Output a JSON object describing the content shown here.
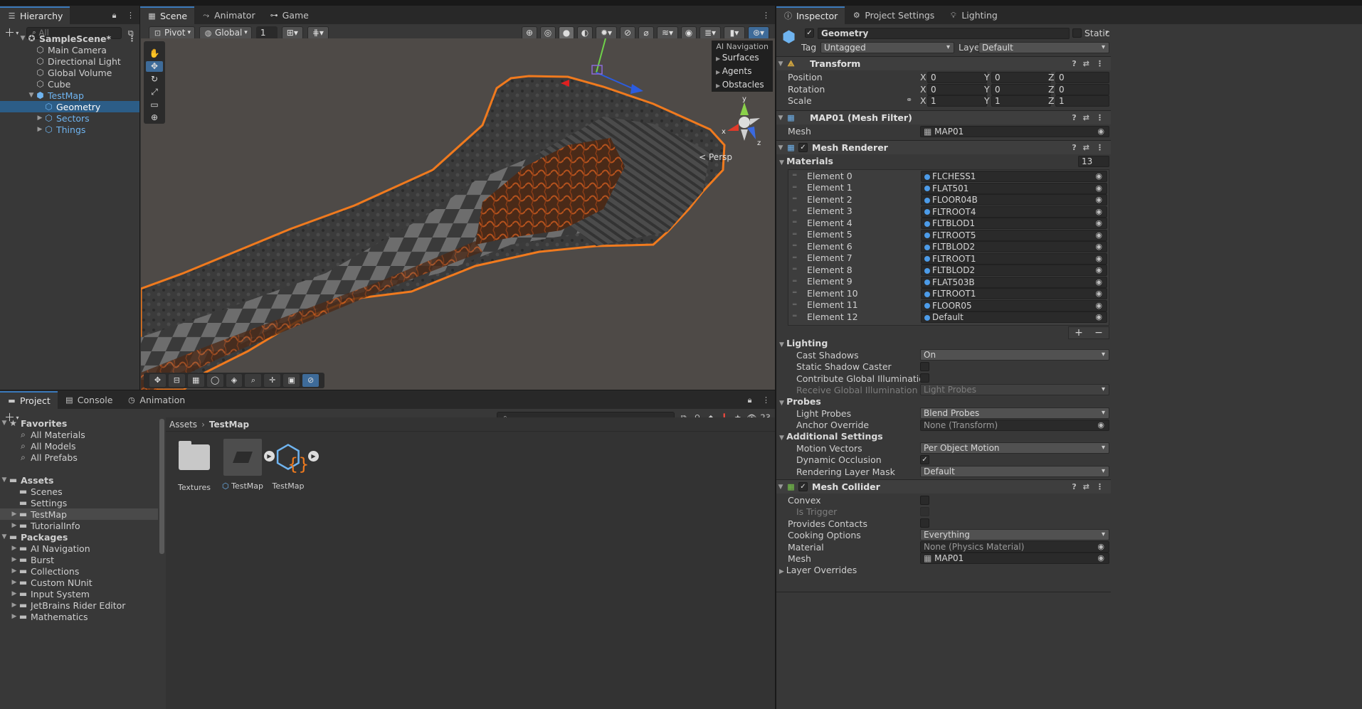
{
  "hierarchy": {
    "tab_label": "Hierarchy",
    "search_placeholder": "All",
    "items": [
      {
        "label": "SampleScene*"
      },
      {
        "label": "Main Camera"
      },
      {
        "label": "Directional Light"
      },
      {
        "label": "Global Volume"
      },
      {
        "label": "Cube"
      },
      {
        "label": "TestMap"
      },
      {
        "label": "Geometry"
      },
      {
        "label": "Sectors"
      },
      {
        "label": "Things"
      }
    ]
  },
  "scene": {
    "tabs": [
      "Scene",
      "Animator",
      "Game"
    ],
    "pivot_label": "Pivot",
    "global_label": "Global",
    "grid_value": "1",
    "ai_navigation": {
      "title": "AI Navigation",
      "items": [
        "Surfaces",
        "Agents",
        "Obstacles"
      ]
    },
    "gizmo_axes": {
      "x": "x",
      "y": "y",
      "z": "z"
    },
    "persp_label": "Persp"
  },
  "inspector": {
    "tabs": [
      "Inspector",
      "Project Settings",
      "Lighting"
    ],
    "object_name": "Geometry",
    "static_label": "Static",
    "tag_label": "Tag",
    "tag_value": "Untagged",
    "layer_label": "Layer",
    "layer_value": "Default",
    "transform": {
      "title": "Transform",
      "position_label": "Position",
      "rotation_label": "Rotation",
      "scale_label": "Scale",
      "x_label": "X",
      "y_label": "Y",
      "z_label": "Z",
      "position": [
        "0",
        "0",
        "0"
      ],
      "rotation": [
        "0",
        "0",
        "0"
      ],
      "scale": [
        "1",
        "1",
        "1"
      ]
    },
    "mesh_filter": {
      "title": "MAP01 (Mesh Filter)",
      "mesh_label": "Mesh",
      "mesh_value": "MAP01"
    },
    "mesh_renderer": {
      "title": "Mesh Renderer",
      "materials_label": "Materials",
      "materials_count": "13",
      "elements": [
        {
          "label": "Element 0",
          "value": "FLCHESS1"
        },
        {
          "label": "Element 1",
          "value": "FLAT501"
        },
        {
          "label": "Element 2",
          "value": "FLOOR04B"
        },
        {
          "label": "Element 3",
          "value": "FLTROOT4"
        },
        {
          "label": "Element 4",
          "value": "FLTBLOD1"
        },
        {
          "label": "Element 5",
          "value": "FLTROOT5"
        },
        {
          "label": "Element 6",
          "value": "FLTBLOD2"
        },
        {
          "label": "Element 7",
          "value": "FLTROOT1"
        },
        {
          "label": "Element 8",
          "value": "FLTBLOD2"
        },
        {
          "label": "Element 9",
          "value": "FLAT503B"
        },
        {
          "label": "Element 10",
          "value": "FLTROOT1"
        },
        {
          "label": "Element 11",
          "value": "FLOOR05"
        },
        {
          "label": "Element 12",
          "value": "Default"
        }
      ],
      "add_label": "+",
      "remove_label": "−",
      "lighting_label": "Lighting",
      "cast_shadows_label": "Cast Shadows",
      "cast_shadows_value": "On",
      "static_shadow_label": "Static Shadow Caster",
      "contribute_gi_label": "Contribute Global Illumination",
      "receive_gi_label": "Receive Global Illumination",
      "receive_gi_value": "Light Probes",
      "probes_label": "Probes",
      "light_probes_label": "Light Probes",
      "light_probes_value": "Blend Probes",
      "anchor_label": "Anchor Override",
      "anchor_value": "None (Transform)",
      "additional_label": "Additional Settings",
      "motion_vectors_label": "Motion Vectors",
      "motion_vectors_value": "Per Object Motion",
      "dynamic_occlusion_label": "Dynamic Occlusion",
      "rendering_layer_label": "Rendering Layer Mask",
      "rendering_layer_value": "Default"
    },
    "mesh_collider": {
      "title": "Mesh Collider",
      "convex_label": "Convex",
      "is_trigger_label": "Is Trigger",
      "provides_contacts_label": "Provides Contacts",
      "cooking_label": "Cooking Options",
      "cooking_value": "Everything",
      "material_label": "Material",
      "material_value": "None (Physics Material)",
      "mesh_label": "Mesh",
      "mesh_value": "MAP01",
      "layer_overrides_label": "Layer Overrides"
    }
  },
  "project": {
    "tabs": [
      "Project",
      "Console",
      "Animation"
    ],
    "count_label": "23",
    "favorites_label": "Favorites",
    "favorites": [
      "All Materials",
      "All Models",
      "All Prefabs"
    ],
    "assets_label": "Assets",
    "assets": [
      "Scenes",
      "Settings",
      "TestMap",
      "TutorialInfo"
    ],
    "packages_label": "Packages",
    "packages": [
      "AI Navigation",
      "Burst",
      "Collections",
      "Custom NUnit",
      "Input System",
      "JetBrains Rider Editor",
      "Mathematics"
    ],
    "breadcrumb": [
      "Assets",
      "TestMap"
    ],
    "breadcrumb_sep": "›",
    "grid_items": [
      "Textures",
      "TestMap",
      "TestMap"
    ]
  },
  "colors": {
    "accent_blue": "#3a79bb",
    "selection": "#2c5d87",
    "outline_orange": "#f07a1e",
    "panel_bg": "#383838",
    "tabbar_bg": "#282828"
  }
}
